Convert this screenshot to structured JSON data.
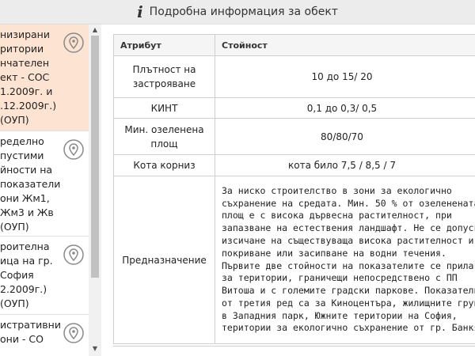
{
  "header": {
    "title": "Подробна информация за обект",
    "icon": "info-icon"
  },
  "list": {
    "items": [
      {
        "text": "низирани\nритории\nнчателен\nект - СОС\n1.2009г. и\n.12.2009г.)\n(ОУП)",
        "selected": true
      },
      {
        "text": "ределно\nпустими\nйности на\nпоказатели\nони Жм1,\nЖм3 и Жв\n(ОУП)",
        "selected": false
      },
      {
        "text": "роителна\nица на гр.\nСофия\n2.2009г.)\n(ОУП)",
        "selected": false
      },
      {
        "text": "истративни\nони - СО",
        "selected": false
      }
    ],
    "pin_icon": "map-pin-icon",
    "selected_color": "#fde3d2"
  },
  "table": {
    "headers": {
      "attribute": "Атрибут",
      "value": "Стойност"
    },
    "rows": [
      {
        "attr": "Плътност на\nзастрояване",
        "value": "10 до 15/ 20"
      },
      {
        "attr": "КИНТ",
        "value": "0,1 до 0,3/ 0,5"
      },
      {
        "attr": "Мин. озеленена\nплощ",
        "value": "80/80/70"
      },
      {
        "attr": "Кота корниз",
        "value": "кота било 7,5 / 8,5 / 7"
      },
      {
        "attr": "Предназначение",
        "value": "За ниско строителство в зони за екологично\nсъхранение на средата. Мин. 50 % от озеленената\nплощ е с висока дървесна растителност, при\nзапазване на естествения ландшафт. Не се допуска\nизсичане на съществуваща висока растителност и\nпокриване или засипване на водни течения.\nПървите две стойности на показателите се прилага\nза територии, граничещи непосредствено с ПП\nВитоша и с големите градски паркове. Показатели\nот третия ред са за Киноцентъра, жилищните групи\nв Западния парк, Южните територии на София,\nтеритории за екологично съхранение от гр. Банкя"
      }
    ]
  }
}
